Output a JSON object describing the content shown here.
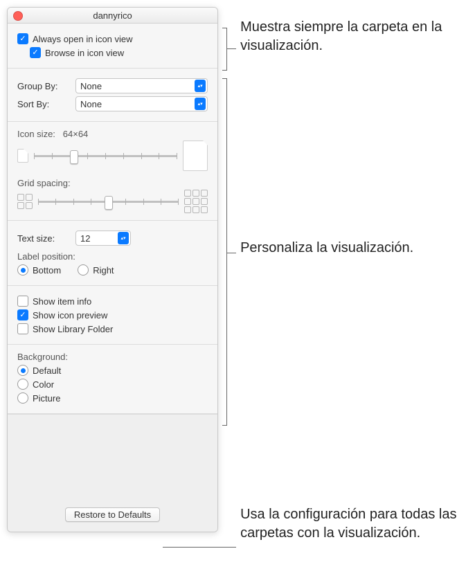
{
  "window": {
    "title": "dannyrico"
  },
  "top": {
    "always_open": "Always open in icon view",
    "browse": "Browse in icon view"
  },
  "group_sort": {
    "group_label": "Group By:",
    "group_value": "None",
    "sort_label": "Sort By:",
    "sort_value": "None"
  },
  "icon": {
    "size_label": "Icon size:",
    "size_value": "64×64",
    "grid_label": "Grid spacing:"
  },
  "text": {
    "size_label": "Text size:",
    "size_value": "12",
    "pos_label": "Label position:",
    "pos_bottom": "Bottom",
    "pos_right": "Right"
  },
  "show": {
    "item_info": "Show item info",
    "icon_preview": "Show icon preview",
    "library": "Show Library Folder"
  },
  "bg": {
    "label": "Background:",
    "default": "Default",
    "color": "Color",
    "picture": "Picture"
  },
  "footer": {
    "restore": "Restore to Defaults"
  },
  "anno": {
    "a1": "Muestra siempre la carpeta en la visualización.",
    "a2": "Personaliza la visualización.",
    "a3": "Usa la configuración para todas las carpetas con la visualización."
  }
}
